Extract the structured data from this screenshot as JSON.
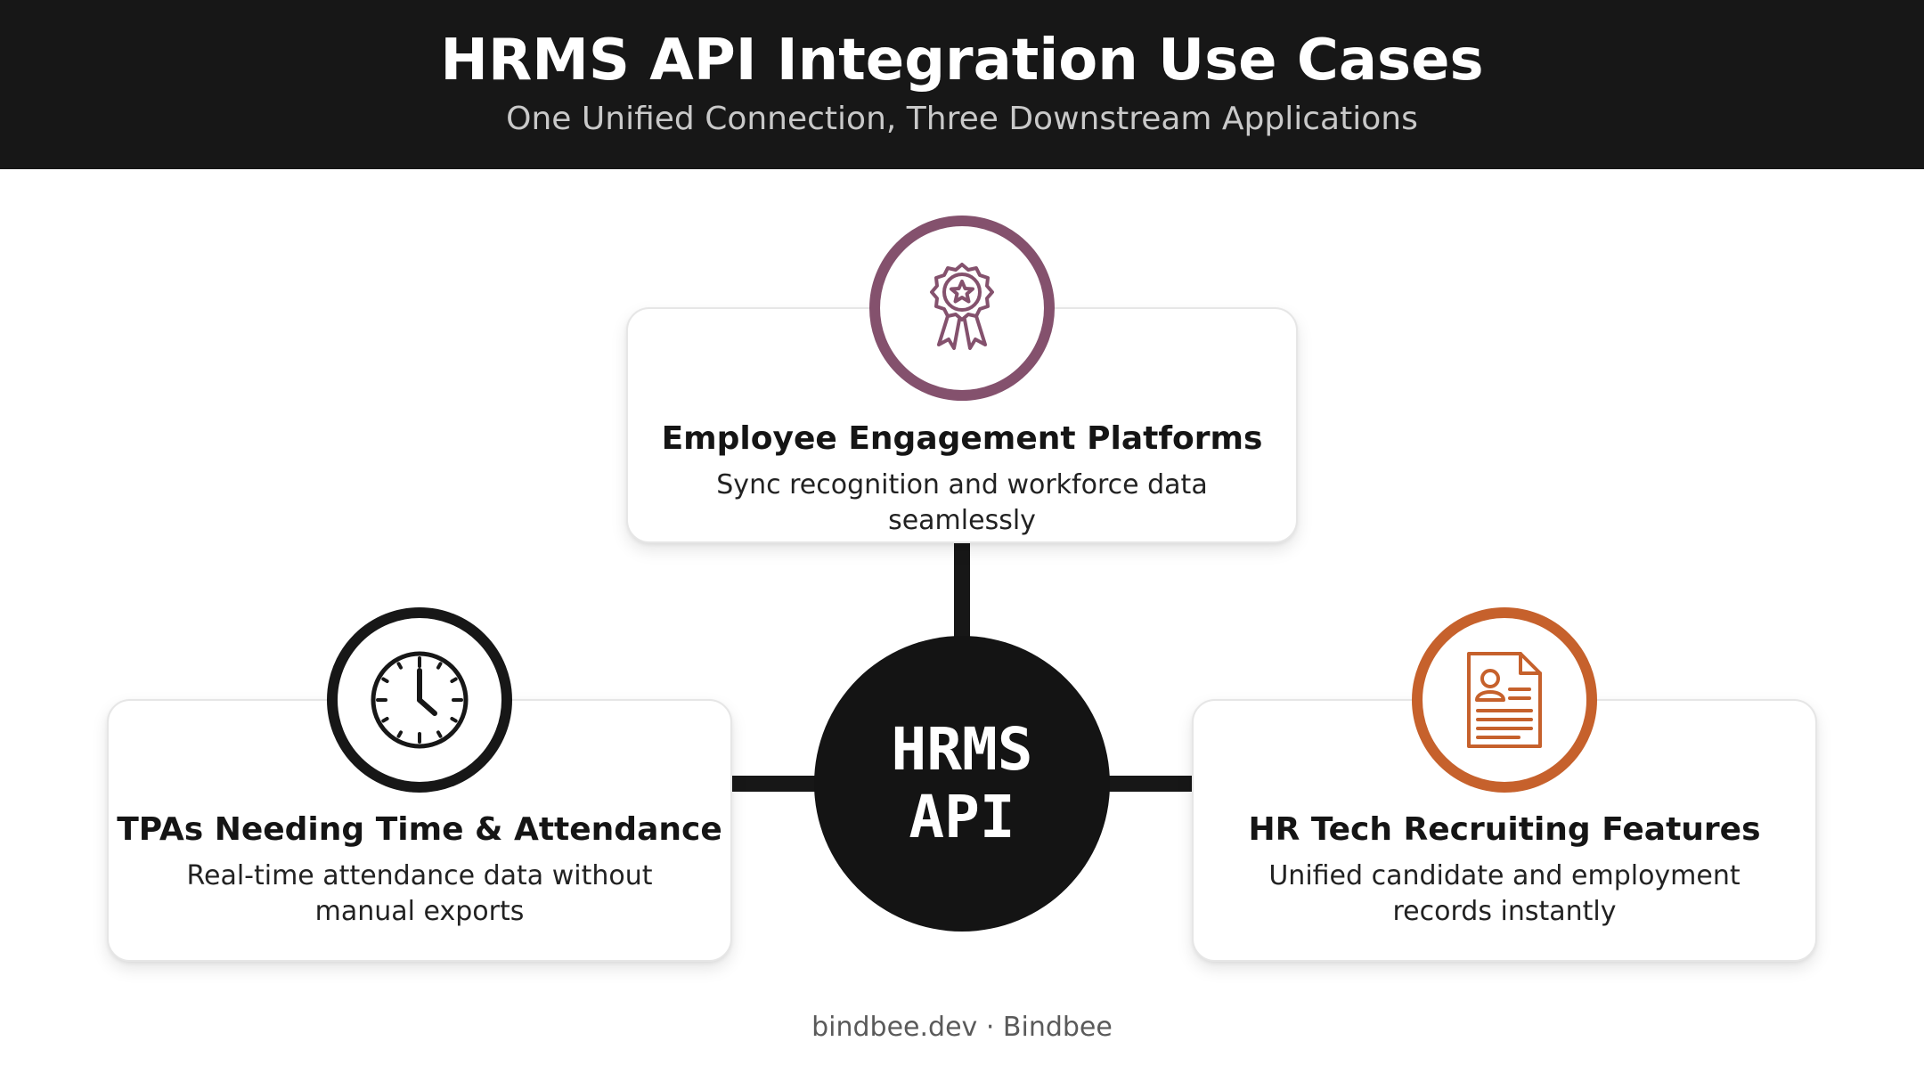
{
  "header": {
    "title": "HRMS API Integration Use Cases",
    "subtitle": "One Unified Connection, Three Downstream Applications"
  },
  "hub": {
    "line1": "HRMS",
    "line2": "API"
  },
  "cards": {
    "top": {
      "icon": "award-ribbon-icon",
      "accent": "#84516d",
      "title": "Employee Engagement Platforms",
      "description": "Sync recognition and workforce data seamlessly"
    },
    "left": {
      "icon": "clock-icon",
      "accent": "#171717",
      "title": "TPAs Needing Time & Attendance",
      "description": "Real-time attendance data without manual exports"
    },
    "right": {
      "icon": "resume-document-icon",
      "accent": "#c6612c",
      "title": "HR Tech Recruiting Features",
      "description": "Unified candidate and employment records instantly"
    }
  },
  "footer": {
    "text": "bindbee.dev · Bindbee"
  }
}
